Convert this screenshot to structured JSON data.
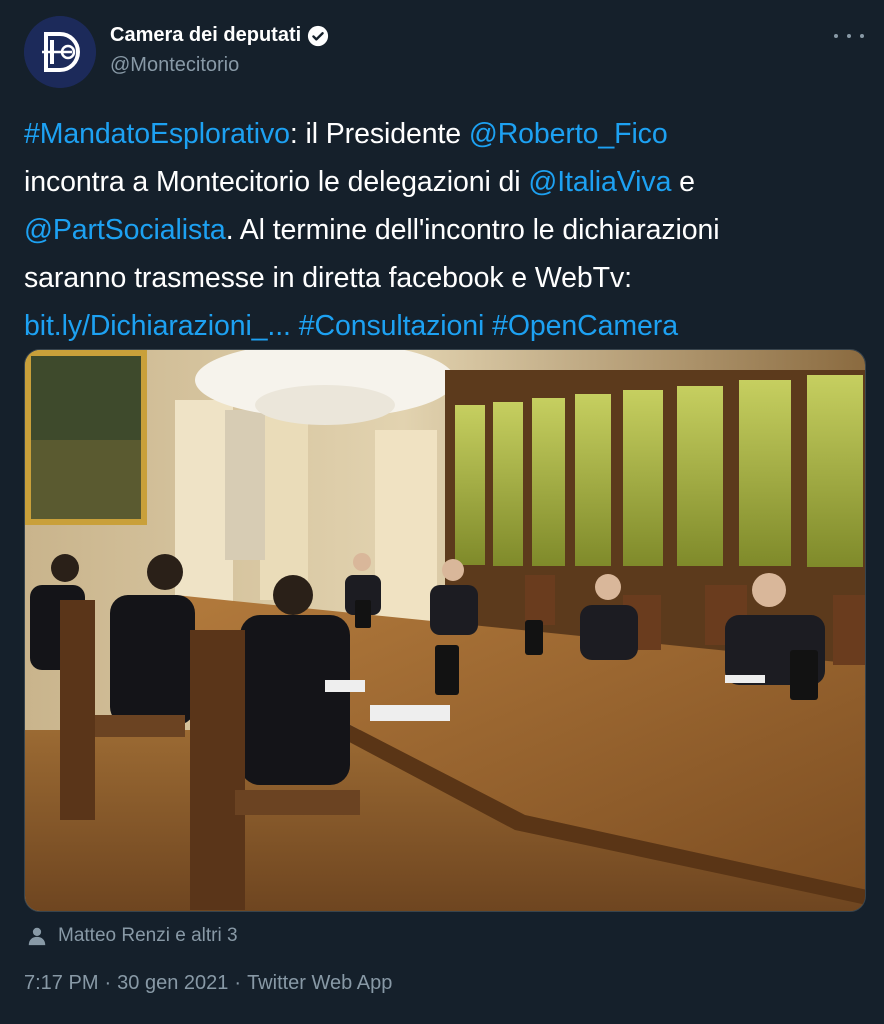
{
  "author": {
    "name": "Camera dei deputati",
    "handle": "@Montecitorio"
  },
  "tweet": {
    "segments_line1": [
      "#MandatoEsplorativo",
      ": il Presidente ",
      "@Roberto_Fico"
    ],
    "segments_line2": [
      "incontra a Montecitorio le delegazioni di ",
      "@ItaliaViva",
      " e"
    ],
    "segments_line3": [
      "@PartSocialista",
      ". Al termine dell'incontro le dichiarazioni"
    ],
    "segments_line4": [
      "saranno trasmesse in diretta facebook e WebTv:"
    ],
    "segments_line5": [
      "bit.ly/Dichiarazioni_...",
      " ",
      "#Consultazioni",
      " ",
      "#OpenCamera"
    ]
  },
  "tagged": {
    "label": "Matteo Renzi e altri 3",
    "icon": "person-icon"
  },
  "meta": {
    "time": "7:17 PM",
    "separator1": "·",
    "date": "30 gen 2021",
    "separator2": "·",
    "source": "Twitter Web App"
  },
  "colors": {
    "background": "#15202b",
    "link": "#1da1f2",
    "secondary_text": "#8899a6",
    "border": "#38444d"
  }
}
